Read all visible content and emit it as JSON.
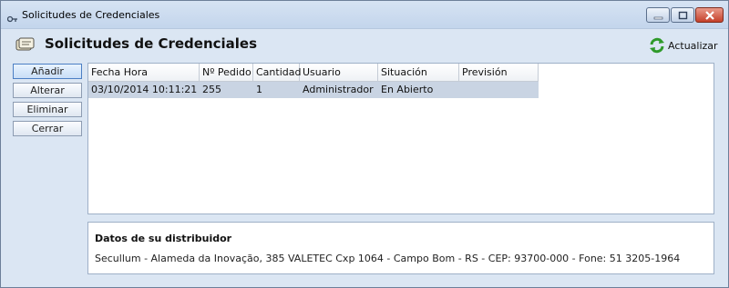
{
  "window": {
    "title": "Solicitudes de Credenciales",
    "icon": "key-icon"
  },
  "header": {
    "title": "Solicitudes de Credenciales",
    "icon": "credentials-icon",
    "refresh_label": "Actualizar",
    "refresh_icon": "refresh-icon"
  },
  "actions": {
    "add": "Añadir",
    "edit": "Alterar",
    "delete": "Eliminar",
    "close": "Cerrar"
  },
  "table": {
    "columns": [
      "Fecha Hora",
      "Nº Pedido",
      "Cantidad",
      "Usuario",
      "Situación",
      "Previsión"
    ],
    "rows": [
      [
        "03/10/2014 10:11:21",
        "255",
        "1",
        "Administrador",
        "En Abierto",
        ""
      ]
    ]
  },
  "distributor": {
    "title": "Datos de su distribuidor",
    "text": "Secullum - Alameda da Inovação, 385  VALETEC Cxp 1064 - Campo Bom - RS - CEP: 93700-000 - Fone: 51 3205-1964"
  },
  "colors": {
    "selected_row": "#c9d4e3",
    "window_bg": "#dbe6f3",
    "close_button": "#c5402a"
  }
}
